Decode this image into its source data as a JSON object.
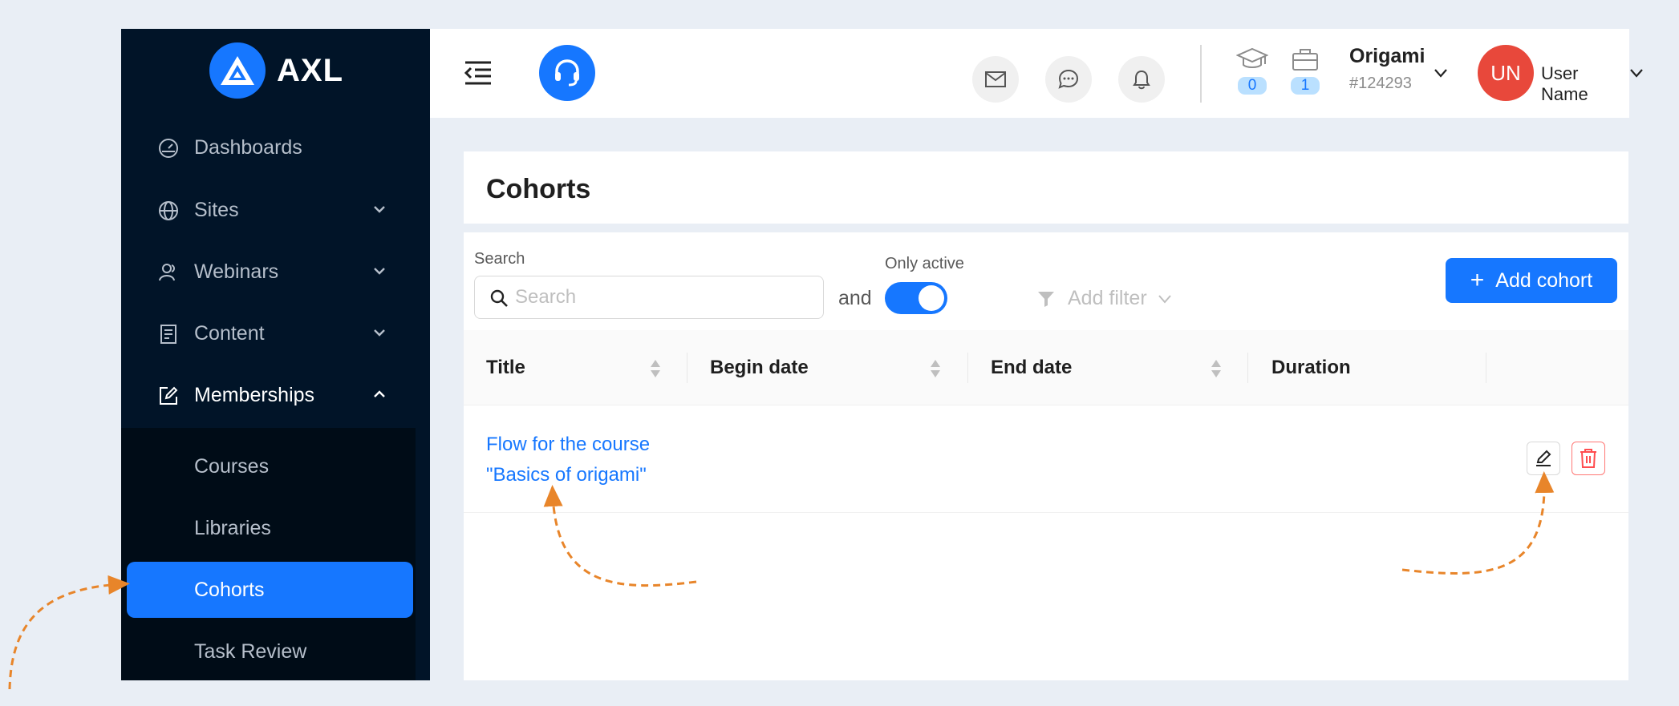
{
  "colors": {
    "primary": "#1677ff",
    "sidebar_bg": "#011428",
    "submenu_bg": "#000c17",
    "danger": "#ff4d4f",
    "avatar_bg": "#e8483b",
    "annotation": "#e8852a"
  },
  "brand": {
    "name": "AXL",
    "logo_icon": "triangle-logo-icon"
  },
  "sidebar": {
    "items": [
      {
        "label": "Dashboards",
        "icon": "dashboard-icon"
      },
      {
        "label": "Sites",
        "icon": "globe-icon"
      },
      {
        "label": "Webinars",
        "icon": "users-icon"
      },
      {
        "label": "Content",
        "icon": "document-icon"
      },
      {
        "label": "Memberships",
        "icon": "edit-square-icon"
      }
    ],
    "submenu": [
      {
        "label": "Courses"
      },
      {
        "label": "Libraries"
      },
      {
        "label": "Cohorts",
        "active": true
      },
      {
        "label": "Task Review"
      }
    ]
  },
  "header": {
    "mail_icon": "mail-icon",
    "chat_icon": "chat-icon",
    "bell_icon": "bell-icon",
    "courses_count": "0",
    "jobs_count": "1",
    "org_name": "Origami",
    "org_id": "#124293",
    "avatar_initials": "UN",
    "user_name": "User Name"
  },
  "page": {
    "title": "Cohorts",
    "search_label": "Search",
    "search_placeholder": "Search",
    "search_value": "",
    "and_text": "and",
    "only_active_label": "Only active",
    "only_active": true,
    "add_filter_label": "Add filter",
    "add_cohort_label": "Add cohort"
  },
  "table": {
    "columns": [
      "Title",
      "Begin date",
      "End date",
      "Duration"
    ],
    "rows": [
      {
        "title_line1": "Flow for the course",
        "title_line2": "\"Basics of origami\"",
        "begin": "",
        "end": "",
        "duration": ""
      }
    ]
  }
}
